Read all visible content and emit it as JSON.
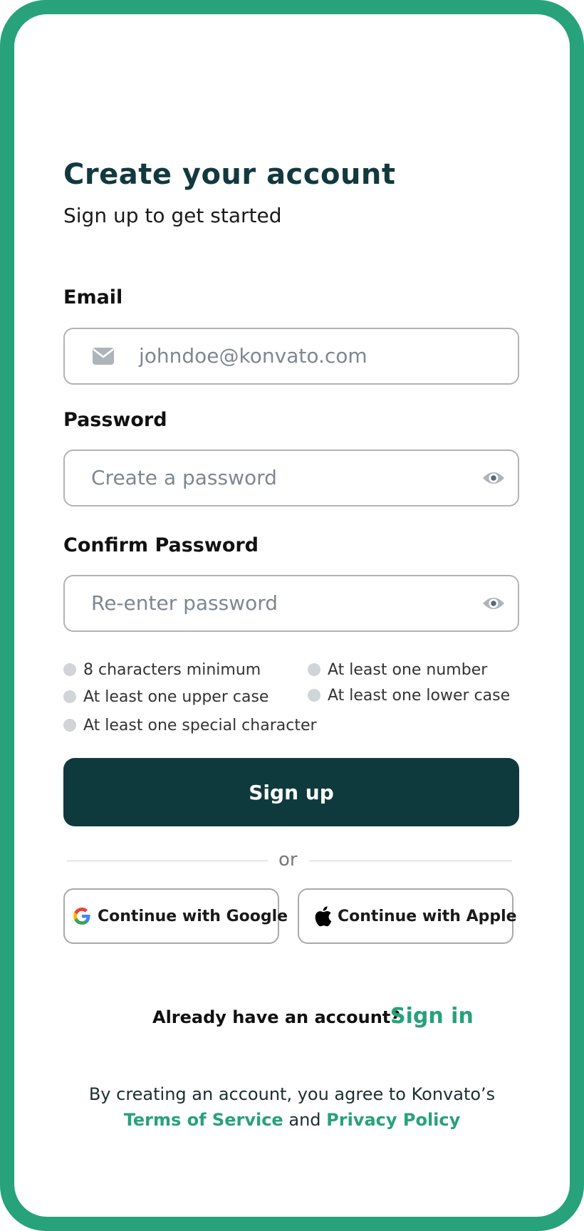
{
  "header": {
    "title": "Create your account",
    "subtitle": "Sign up to get started"
  },
  "form": {
    "email": {
      "label": "Email",
      "placeholder": "johndoe@konvato.com",
      "icon": "mail-icon"
    },
    "password": {
      "label": "Password",
      "placeholder": "Create a password",
      "icon": "eye-icon"
    },
    "confirm_password": {
      "label": "Confirm Password",
      "placeholder": "Re-enter password",
      "icon": "eye-icon"
    },
    "requirements": [
      "8 characters minimum",
      "At least one number",
      "At least one upper case",
      "At least one lower case",
      "At least one special character"
    ],
    "submit_label": "Sign up"
  },
  "divider": {
    "label": "or"
  },
  "social": {
    "google_label": "Continue with Google",
    "apple_label": "Continue with Apple"
  },
  "signin_prompt": {
    "text": "Already have an account?",
    "link": "Sign in"
  },
  "legal": {
    "text": "By creating an account, you agree to Konvato’s",
    "terms_link": "Terms of Service",
    "conjunction": "and",
    "privacy_link": "Privacy Policy"
  },
  "colors": {
    "accent": "#27a27a",
    "primary_button": "#0f3a3d",
    "title": "#12393d"
  }
}
